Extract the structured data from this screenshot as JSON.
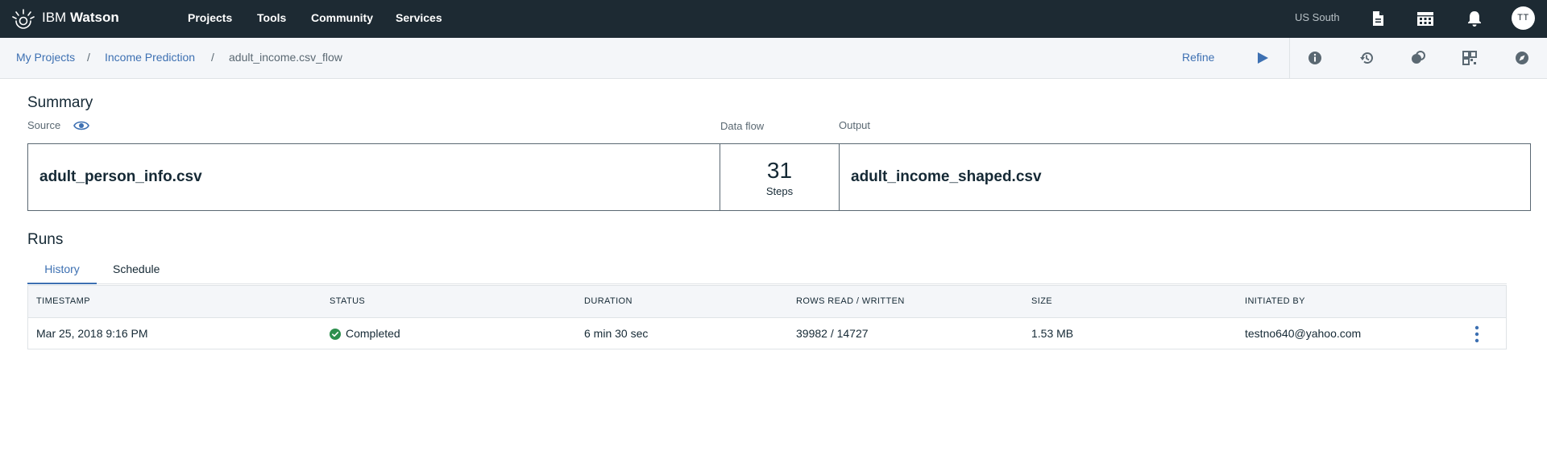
{
  "app": {
    "brand_light": "IBM",
    "brand_bold": "Watson",
    "nav": [
      "Projects",
      "Tools",
      "Community",
      "Services"
    ],
    "region": "US South",
    "avatar_initials": "TT",
    "topbar_icons": [
      "ibm-logo-icon",
      "document-icon",
      "apps-grid-icon",
      "notification-bell-icon"
    ]
  },
  "breadcrumb": {
    "items": [
      "My Projects",
      "Income Prediction",
      "adult_income.csv_flow"
    ],
    "separator": "/"
  },
  "toolbar": {
    "refine_label": "Refine",
    "icons": [
      "run-icon",
      "info-icon",
      "history-icon",
      "collaborators-icon",
      "grid-icon",
      "compass-icon"
    ]
  },
  "summary": {
    "title": "Summary",
    "source_label": "Source",
    "dataflow_label": "Data flow",
    "output_label": "Output",
    "source_file": "adult_person_info.csv",
    "steps_count": "31",
    "steps_label": "Steps",
    "output_file": "adult_income_shaped.csv"
  },
  "runs": {
    "title": "Runs",
    "tabs": [
      "History",
      "Schedule"
    ],
    "active_tab": "History",
    "columns": [
      "TIMESTAMP",
      "STATUS",
      "DURATION",
      "ROWS READ / WRITTEN",
      "SIZE",
      "INITIATED BY"
    ],
    "rows": [
      {
        "timestamp": "Mar 25, 2018 9:16 PM",
        "status": "Completed",
        "duration": "6 min 30 sec",
        "rows": "39982 / 14727",
        "size": "1.53 MB",
        "initiated_by": "testno640@yahoo.com"
      }
    ]
  },
  "colors": {
    "topbar_bg": "#1d2a33",
    "subbar_bg": "#f4f6f9",
    "link_blue": "#3d70b2",
    "status_green": "#2d8f4e",
    "text_dark": "#152935",
    "text_muted": "#5a6872"
  }
}
